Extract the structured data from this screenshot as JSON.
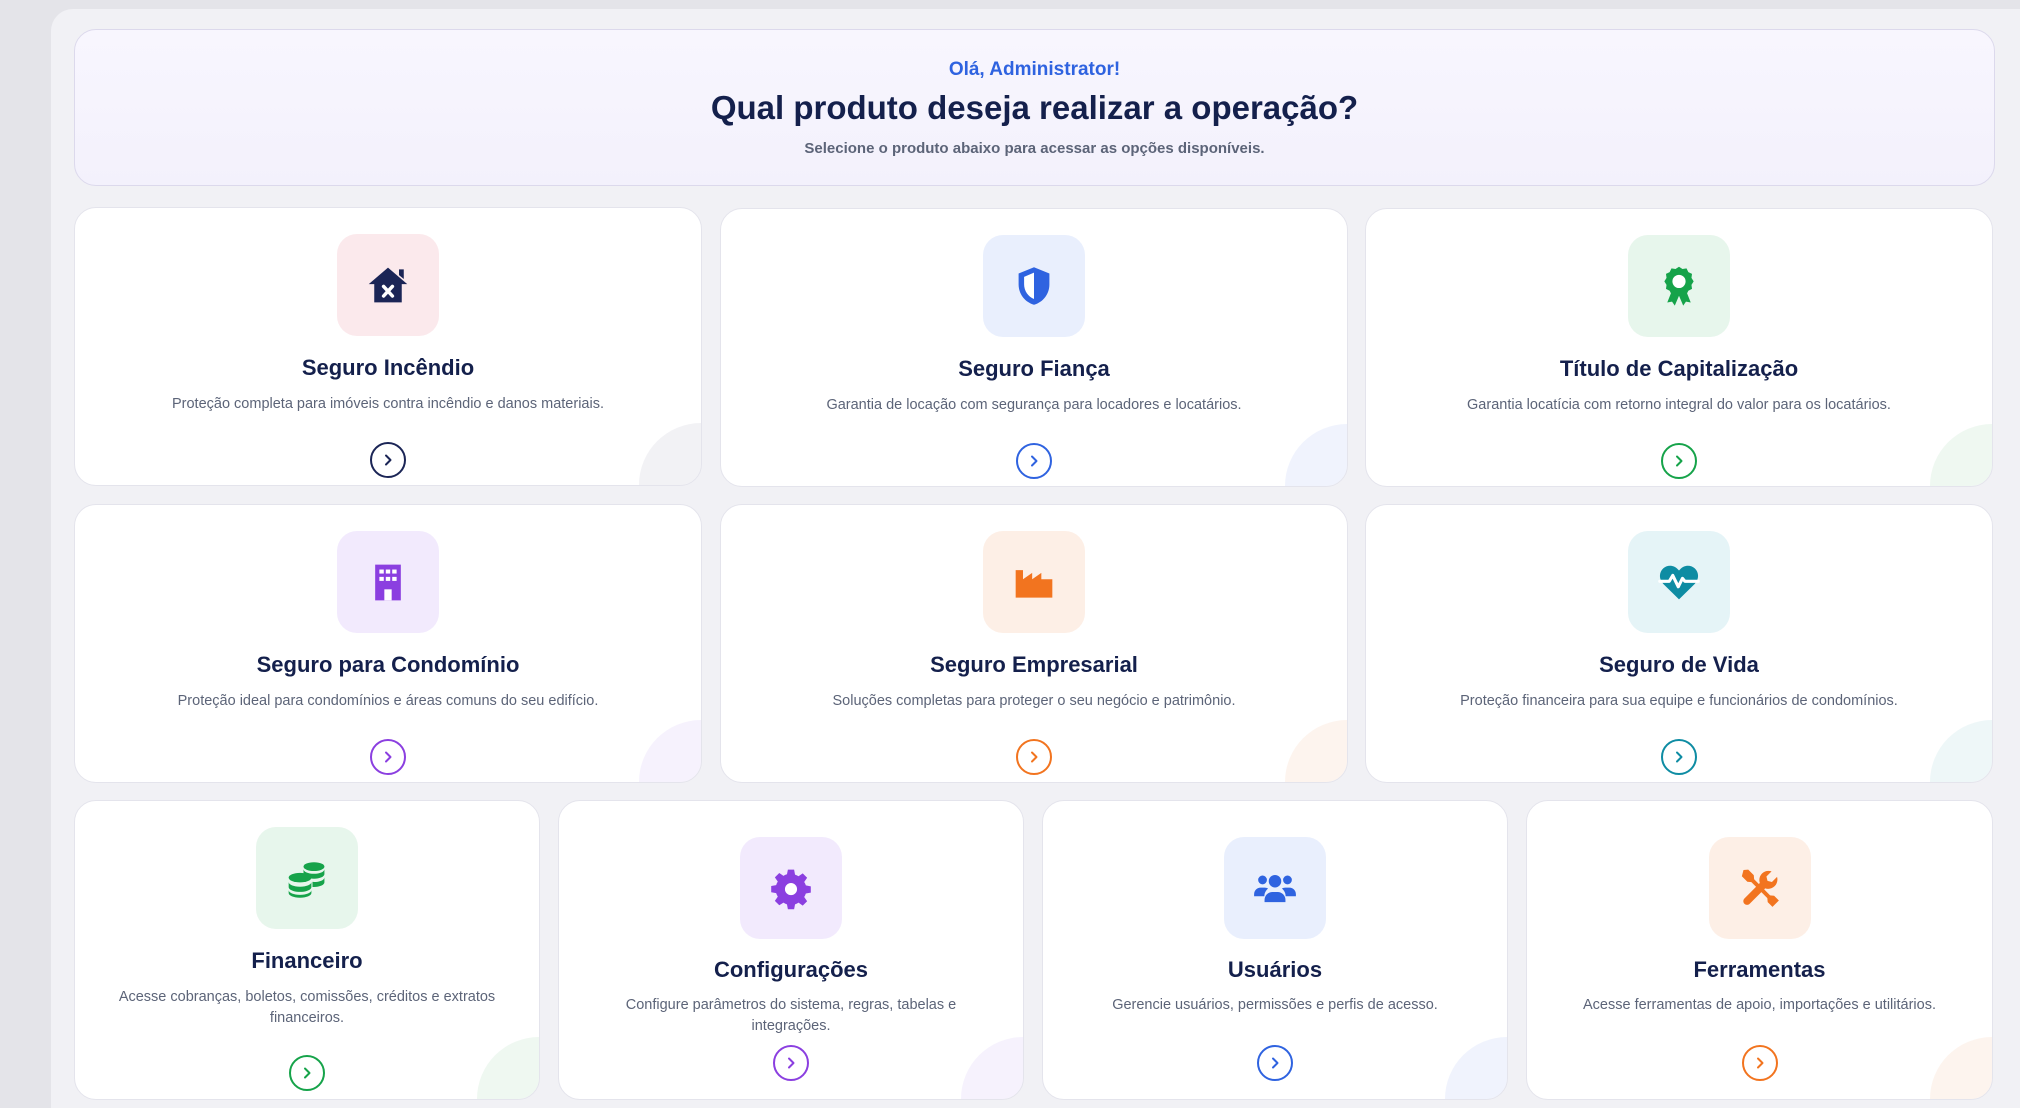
{
  "header": {
    "greeting": "Olá, Administrator!",
    "title": "Qual produto deseja realizar a operação?",
    "subtitle": "Selecione o produto abaixo para acessar as opções disponíveis."
  },
  "colors": {
    "navy": "#1b2556",
    "blue": "#2f63e0",
    "green": "#16a34a",
    "purple": "#8b3fe0",
    "orange": "#f2741f",
    "teal": "#0e8ca3"
  },
  "cards": [
    {
      "id": "seguro-incendio",
      "title": "Seguro Incêndio",
      "description": "Proteção completa para imóveis contra incêndio e danos materiais.",
      "icon": "house-fire-icon",
      "color": "#1b2556",
      "tint": "#fbe9ec",
      "deco": "#e7e7ec"
    },
    {
      "id": "seguro-fianca",
      "title": "Seguro Fiança",
      "description": "Garantia de locação com segurança para locadores e locatários.",
      "icon": "shield-icon",
      "color": "#2f63e0",
      "tint": "#e9effd",
      "deco": "#e3e9fb"
    },
    {
      "id": "titulo-capitalizacao",
      "title": "Título de Capitalização",
      "description": "Garantia locatícia com retorno integral do valor para os locatários.",
      "icon": "award-ribbon-icon",
      "color": "#16a34a",
      "tint": "#e7f6ec",
      "deco": "#e2f2e6"
    },
    {
      "id": "seguro-condominio",
      "title": "Seguro para Condomínio",
      "description": "Proteção ideal para condomínios e áreas comuns do seu edifício.",
      "icon": "building-icon",
      "color": "#8b3fe0",
      "tint": "#f2eafd",
      "deco": "#eee7fb"
    },
    {
      "id": "seguro-empresarial",
      "title": "Seguro Empresarial",
      "description": "Soluções completas para proteger o seu negócio e patrimônio.",
      "icon": "factory-icon",
      "color": "#f2741f",
      "tint": "#fdefe6",
      "deco": "#fcebe0"
    },
    {
      "id": "seguro-vida",
      "title": "Seguro de Vida",
      "description": "Proteção financeira para sua equipe e funcionários de condomínios.",
      "icon": "heart-pulse-icon",
      "color": "#0e8ca3",
      "tint": "#e5f4f7",
      "deco": "#e0f0f3"
    },
    {
      "id": "financeiro",
      "title": "Financeiro",
      "description": "Acesse cobranças, boletos, comissões, créditos e extratos financeiros.",
      "icon": "coins-icon",
      "color": "#16a34a",
      "tint": "#e7f6ec",
      "deco": "#e2f2e6"
    },
    {
      "id": "configuracoes",
      "title": "Configurações",
      "description": "Configure parâmetros do sistema, regras, tabelas e integrações.",
      "icon": "gear-icon",
      "color": "#8b3fe0",
      "tint": "#f2eafd",
      "deco": "#eee7fb"
    },
    {
      "id": "usuarios",
      "title": "Usuários",
      "description": "Gerencie usuários, permissões e perfis de acesso.",
      "icon": "users-icon",
      "color": "#2f63e0",
      "tint": "#e9effd",
      "deco": "#e3e9fb"
    },
    {
      "id": "ferramentas",
      "title": "Ferramentas",
      "description": "Acesse ferramentas de apoio, importações e utilitários.",
      "icon": "tools-icon",
      "color": "#f2741f",
      "tint": "#fdefe6",
      "deco": "#fcebe0"
    }
  ]
}
